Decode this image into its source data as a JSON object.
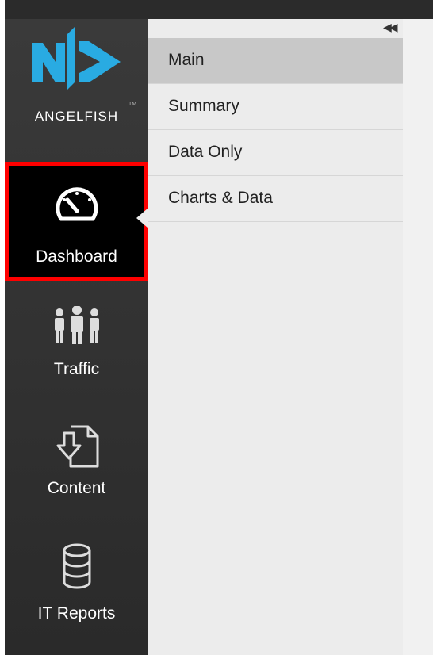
{
  "brand": {
    "name": "ANGELFISH",
    "trademark": "TM",
    "accent": "#29abe2"
  },
  "nav": {
    "items": [
      {
        "label": "Dashboard",
        "icon": "speedometer-icon",
        "active": true
      },
      {
        "label": "Traffic",
        "icon": "people-icon"
      },
      {
        "label": "Content",
        "icon": "download-document-icon"
      },
      {
        "label": "IT Reports",
        "icon": "database-icon"
      }
    ]
  },
  "submenu": {
    "collapse_label": "◀◀",
    "items": [
      {
        "label": "Main",
        "active": true
      },
      {
        "label": "Summary"
      },
      {
        "label": "Data Only"
      },
      {
        "label": "Charts & Data"
      }
    ]
  },
  "colors": {
    "highlight": "#ff0000",
    "sidebar": "#333333",
    "submenu": "#ececec"
  }
}
